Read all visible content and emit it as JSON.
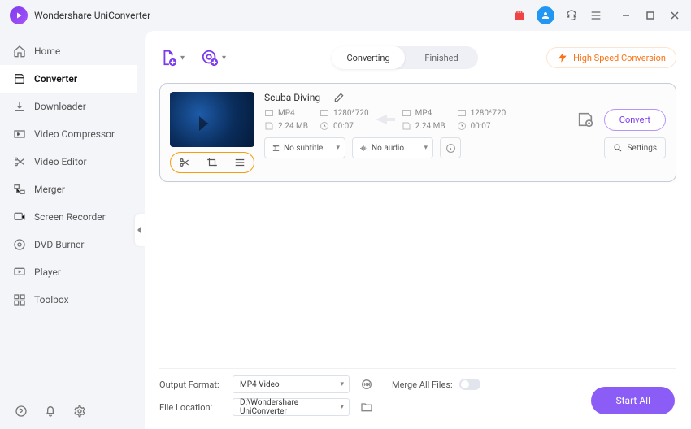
{
  "app": {
    "title": "Wondershare UniConverter"
  },
  "sidebar": {
    "items": [
      {
        "label": "Home"
      },
      {
        "label": "Converter"
      },
      {
        "label": "Downloader"
      },
      {
        "label": "Video Compressor"
      },
      {
        "label": "Video Editor"
      },
      {
        "label": "Merger"
      },
      {
        "label": "Screen Recorder"
      },
      {
        "label": "DVD Burner"
      },
      {
        "label": "Player"
      },
      {
        "label": "Toolbox"
      }
    ]
  },
  "toolbar": {
    "tabs": {
      "converting": "Converting",
      "finished": "Finished"
    },
    "high_speed": "High Speed Conversion"
  },
  "file": {
    "title": "Scuba Diving -",
    "src": {
      "format": "MP4",
      "resolution": "1280*720",
      "size": "2.24 MB",
      "duration": "00:07"
    },
    "dst": {
      "format": "MP4",
      "resolution": "1280*720",
      "size": "2.24 MB",
      "duration": "00:07"
    },
    "subtitle": "No subtitle",
    "audio": "No audio",
    "settings": "Settings",
    "convert": "Convert"
  },
  "bottom": {
    "output_format_label": "Output Format:",
    "output_format_value": "MP4 Video",
    "file_location_label": "File Location:",
    "file_location_value": "D:\\Wondershare UniConverter",
    "merge_label": "Merge All Files:",
    "start_all": "Start All"
  }
}
